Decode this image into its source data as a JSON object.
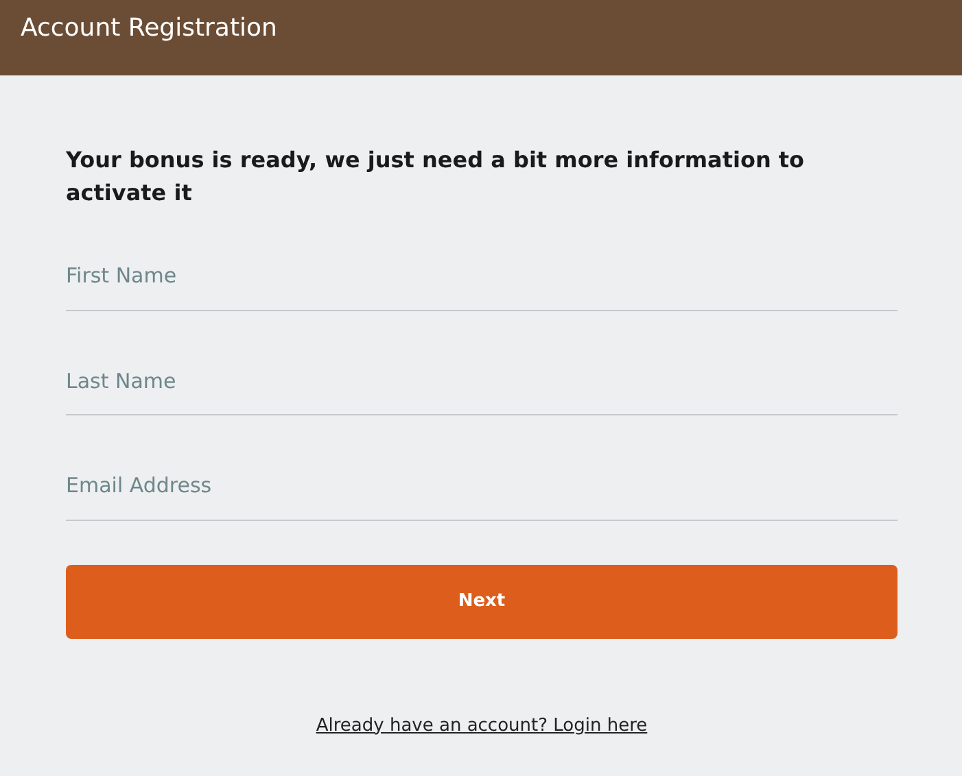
{
  "header": {
    "title": "Account Registration"
  },
  "heading": "Your bonus is ready, we just need a bit more information to activate it",
  "fields": [
    {
      "placeholder": "First Name"
    },
    {
      "placeholder": "Last Name"
    },
    {
      "placeholder": "Email Address"
    }
  ],
  "button": "Next",
  "login_link": "Already have an account? Login here"
}
